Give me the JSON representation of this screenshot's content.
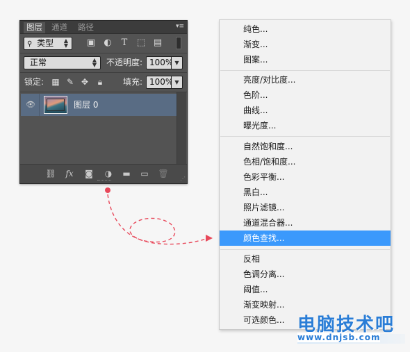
{
  "layers_panel": {
    "tabs": [
      "图层",
      "通道",
      "路径"
    ],
    "active_tab": 0,
    "filter_kind": "类型",
    "blend_mode": "正常",
    "opacity_label": "不透明度:",
    "opacity_value": "100%",
    "lock_label": "锁定:",
    "fill_label": "填充:",
    "fill_value": "100%",
    "layer": {
      "name": "图层 0",
      "visible": true
    }
  },
  "menu": {
    "groups": [
      [
        "纯色...",
        "渐变...",
        "图案..."
      ],
      [
        "亮度/对比度...",
        "色阶...",
        "曲线...",
        "曝光度..."
      ],
      [
        "自然饱和度...",
        "色相/饱和度...",
        "色彩平衡...",
        "黑白...",
        "照片滤镜...",
        "通道混合器...",
        "颜色查找..."
      ],
      [
        "反相",
        "色调分离...",
        "阈值...",
        "渐变映射...",
        "可选颜色..."
      ]
    ],
    "highlighted_item": "颜色查找...",
    "highlight_color": "#3b99fc"
  },
  "annotation": {
    "arrow_color": "#e8485a"
  },
  "watermark": {
    "text": "电脑技术吧",
    "url": "www.dnjsb.com",
    "color": "#2a7dd6"
  },
  "icons": {
    "filter_tools": [
      "image-filter-icon",
      "adjustment-filter-icon",
      "type-filter-icon",
      "shape-filter-icon",
      "smart-object-filter-icon"
    ],
    "locks": [
      "lock-transparent-icon",
      "lock-image-icon",
      "lock-position-icon",
      "lock-all-icon"
    ],
    "bottom": [
      "link-layers-icon",
      "fx-icon",
      "mask-icon",
      "adjustment-layer-icon",
      "group-icon",
      "new-layer-icon",
      "delete-icon"
    ]
  }
}
